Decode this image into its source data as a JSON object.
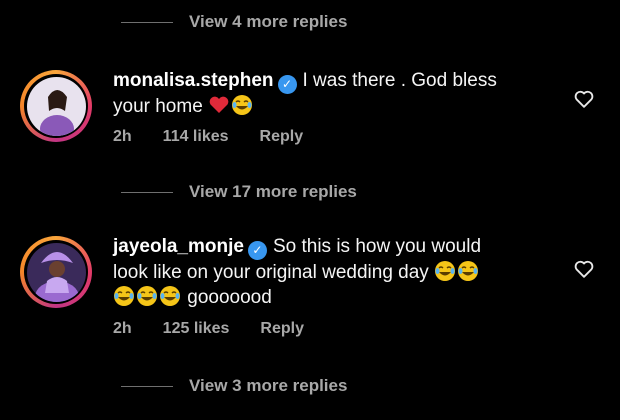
{
  "thread": {
    "view_replies_top": "View 4 more replies",
    "comments": [
      {
        "username": "monalisa.stephen",
        "text_line1": "I was there . God bless",
        "text_line2": "your home",
        "emojis": [
          "red-heart",
          "face-with-tears-of-joy"
        ],
        "time": "2h",
        "likes": "114 likes",
        "reply_label": "Reply",
        "view_replies": "View 17 more replies"
      },
      {
        "username": "jayeola_monje",
        "text_line1": "So this is how you would",
        "text_line2": "look like on your original wedding day",
        "text_line3": "gooooood",
        "emojis": [
          "face-with-tears-of-joy",
          "face-with-tears-of-joy",
          "face-with-tears-of-joy",
          "face-with-tears-of-joy",
          "face-with-tears-of-joy"
        ],
        "time": "2h",
        "likes": "125 likes",
        "reply_label": "Reply",
        "view_replies": "View 3 more replies"
      }
    ]
  },
  "colors": {
    "background": "#000000",
    "muted_text": "#a8a8a8",
    "verified_badge": "#3897f0"
  }
}
